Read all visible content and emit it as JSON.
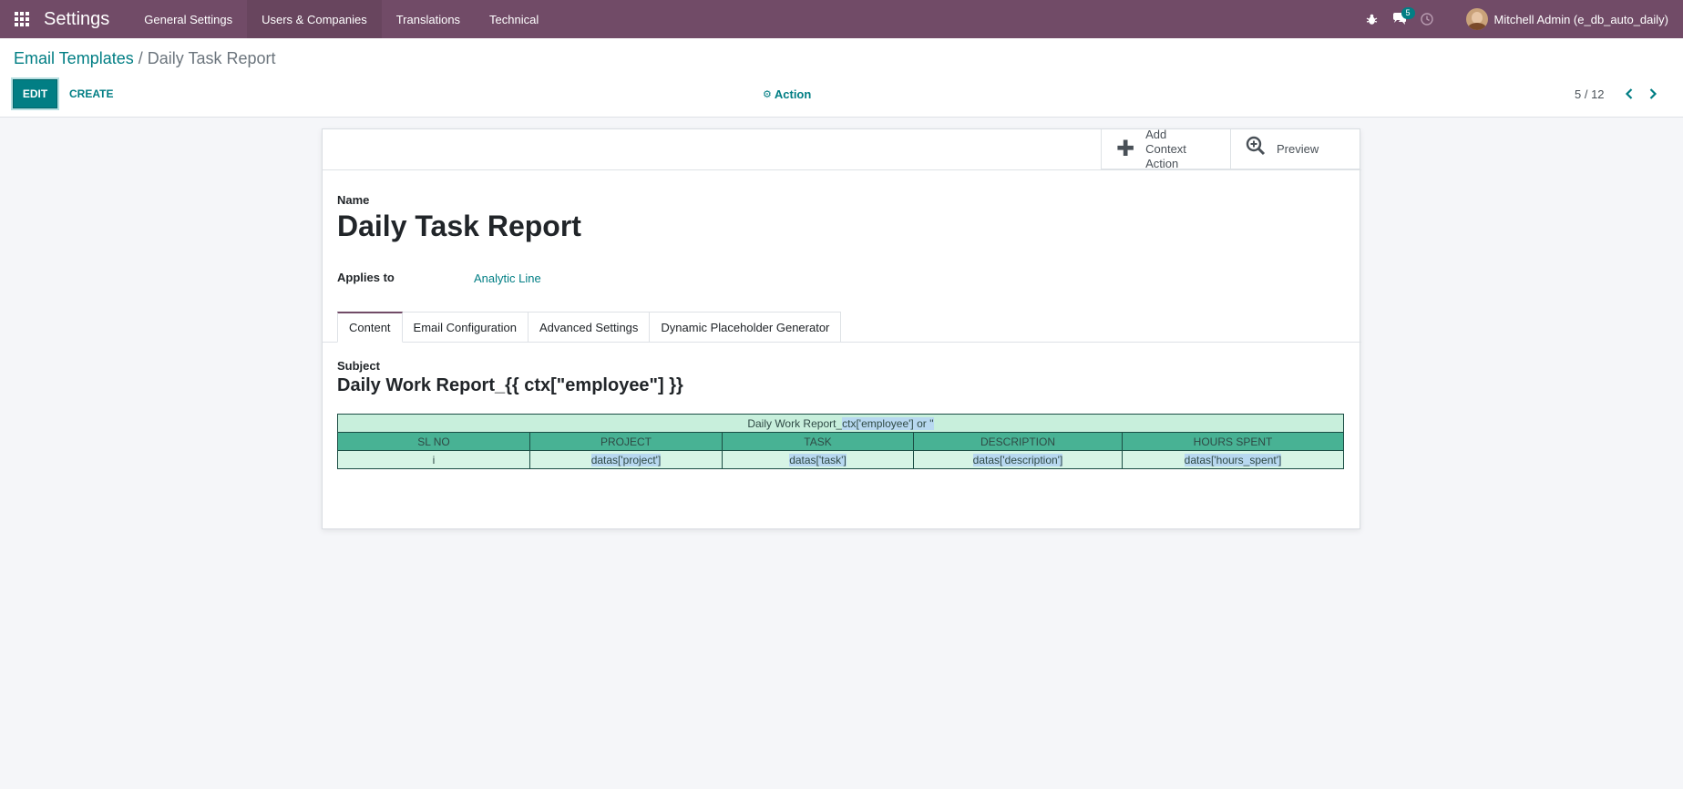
{
  "navbar": {
    "app_name": "Settings",
    "menu": [
      "General Settings",
      "Users & Companies",
      "Translations",
      "Technical"
    ],
    "messages_count": "5",
    "user_name": "Mitchell Admin (e_db_auto_daily)"
  },
  "control_panel": {
    "breadcrumb_parent": "Email Templates",
    "breadcrumb_sep": "/",
    "breadcrumb_current": "Daily Task Report",
    "edit_label": "EDIT",
    "create_label": "CREATE",
    "action_label": "Action",
    "pager_value": "5 / 12"
  },
  "button_box": {
    "add_action_line1": "Add",
    "add_action_line2": "Context Action",
    "preview_label": "Preview"
  },
  "form": {
    "name_label": "Name",
    "name_value": "Daily Task Report",
    "applies_label": "Applies to",
    "applies_value": "Analytic Line",
    "tabs": [
      "Content",
      "Email Configuration",
      "Advanced Settings",
      "Dynamic Placeholder Generator"
    ],
    "subject_label": "Subject",
    "subject_value": "Daily Work Report_{{ ctx[\"employee\"] }}"
  },
  "report_table": {
    "title_prefix": "Daily Work Report_",
    "title_highlight": "ctx['employee'] or ''",
    "headers": [
      "SL NO",
      "PROJECT",
      "TASK",
      "DESCRIPTION",
      "HOURS SPENT"
    ],
    "row": [
      "i",
      "datas['project']",
      "datas['task']",
      "datas['description']",
      "datas['hours_spent']"
    ]
  },
  "colors": {
    "navbar": "#714b67",
    "accent": "#017e84",
    "table_header": "#48b294",
    "table_title": "#c8efdc",
    "table_row": "#d6f4e5"
  }
}
